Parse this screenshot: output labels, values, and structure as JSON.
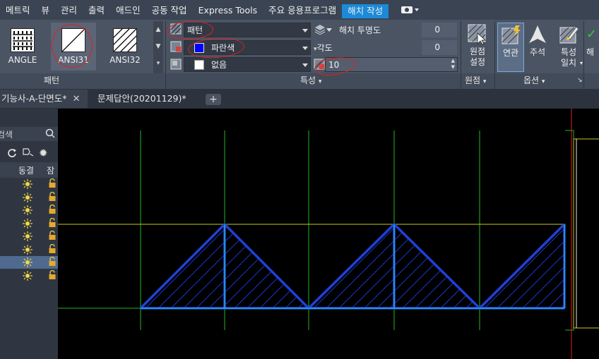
{
  "menu": {
    "items": [
      "메트릭",
      "뷰",
      "관리",
      "출력",
      "애드인",
      "공동 작업",
      "Express Tools",
      "주요 응용프로그램"
    ],
    "active_tab": "해치 작성"
  },
  "ribbon": {
    "patterns": [
      {
        "label": "ANGLE",
        "selected": false
      },
      {
        "label": "ANSI31",
        "selected": true
      },
      {
        "label": "ANSI32",
        "selected": false
      }
    ],
    "pattern_panel_label": "패턴",
    "properties": {
      "type_value": "패턴",
      "color_value": "파란색",
      "background_value": "없음",
      "transparency_label": "해치 투명도",
      "transparency_value": "0",
      "angle_label": "각도",
      "angle_value": "0",
      "scale_value": "10"
    },
    "properties_panel_label": "특성",
    "origin_button": "원점 설정",
    "origin_panel_label": "원점",
    "options": {
      "associative": "연관",
      "annotative": "주석",
      "match_properties": "특성 일치"
    },
    "options_panel_label": "옵션",
    "cut_label": "해"
  },
  "tabs": [
    {
      "label": "기능사-A-단면도*",
      "active": true
    },
    {
      "label": "문제답안(20201129)*",
      "active": false
    }
  ],
  "layers": {
    "search_placeholder": "검색",
    "col_freeze": "동결",
    "col_lock": "잠",
    "row_count": 8,
    "selected_row": 6
  },
  "colors": {
    "accent": "#1b8ad8",
    "hatch_blue": "#1a36c8",
    "grid_green": "#22b822",
    "grid_yellow": "#c8c81e",
    "annotation_red": "#e02020"
  }
}
